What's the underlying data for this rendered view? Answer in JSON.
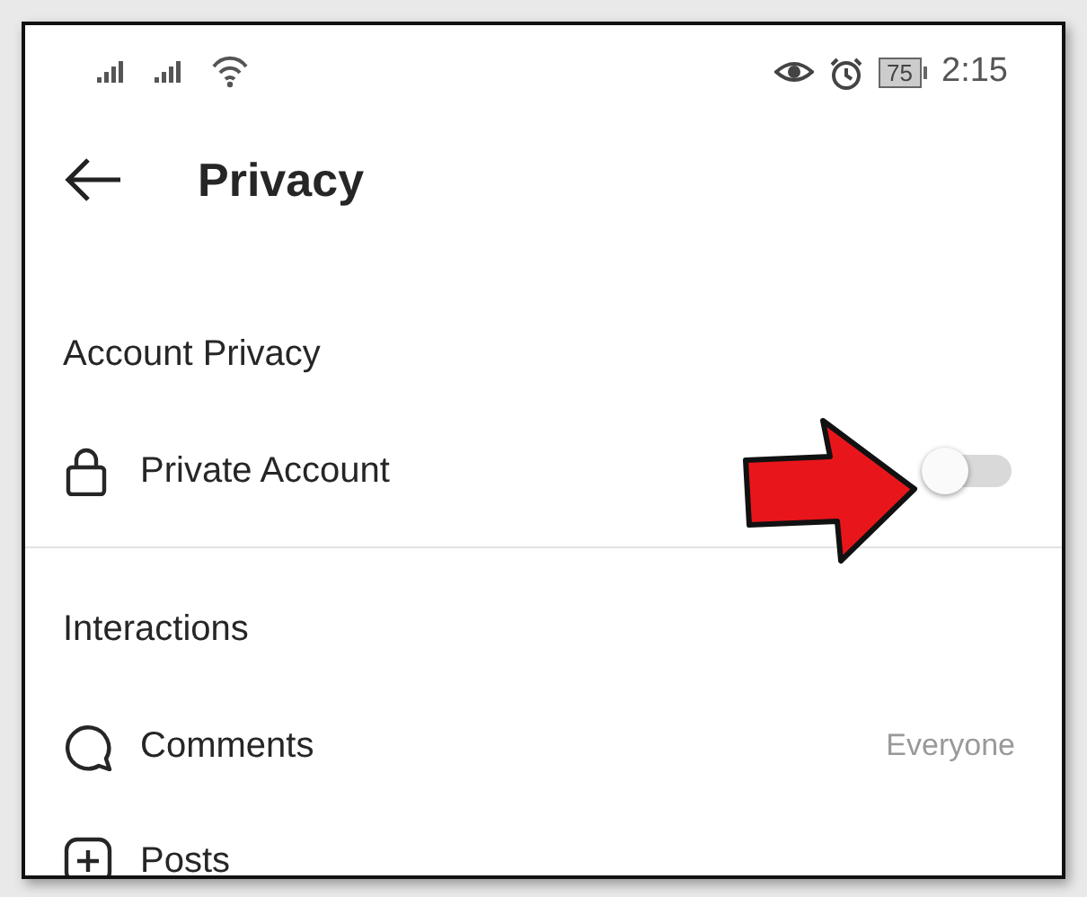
{
  "status_bar": {
    "battery": "75",
    "time": "2:15"
  },
  "header": {
    "title": "Privacy"
  },
  "sections": [
    {
      "title": "Account Privacy",
      "items": [
        {
          "kind": "toggle",
          "label": "Private Account",
          "on": false
        }
      ]
    },
    {
      "title": "Interactions",
      "items": [
        {
          "kind": "value",
          "label": "Comments",
          "value": "Everyone"
        },
        {
          "kind": "link",
          "label": "Posts"
        }
      ]
    }
  ],
  "callout": {
    "kind": "arrow"
  }
}
